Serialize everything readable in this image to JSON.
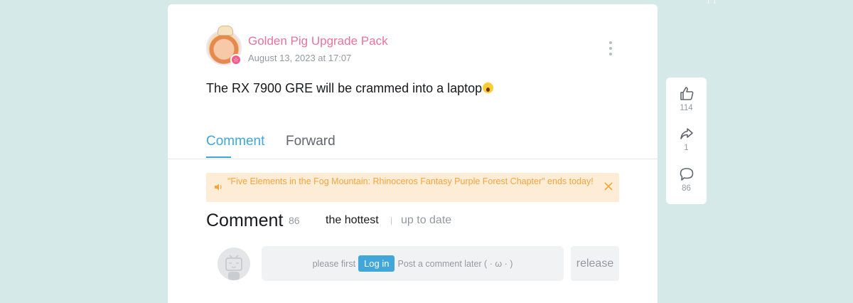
{
  "post": {
    "author": "Golden Pig Upgrade Pack",
    "timestamp": "August 13, 2023 at 17:07",
    "text": "The RX 7900 GRE will be crammed into a laptop"
  },
  "tabs": {
    "comment": "Comment",
    "forward": "Forward"
  },
  "notice": {
    "text": "\"Five Elements in the Fog Mountain: Rhinoceros Fantasy Purple Forest Chapter\" ends today!"
  },
  "comments": {
    "title": "Comment",
    "count": "86",
    "sort_hot": "the hottest",
    "sort_new": "up to date",
    "prompt_before": "please first",
    "login_label": "Log in",
    "prompt_after": "Post a comment later ( · ω · )",
    "release_label": "release"
  },
  "side": {
    "likes": "114",
    "shares": "1",
    "comments": "86"
  },
  "icons": {
    "more": "more-vertical-icon",
    "notice": "speaker-icon",
    "close": "close-icon",
    "like": "thumbs-up-icon",
    "share": "share-icon",
    "comment": "comment-bubble-icon"
  },
  "colors": {
    "accent": "#41a6da",
    "author": "#e8749a",
    "notice_bg": "#fdecd6",
    "notice_text": "#f6a53d"
  }
}
